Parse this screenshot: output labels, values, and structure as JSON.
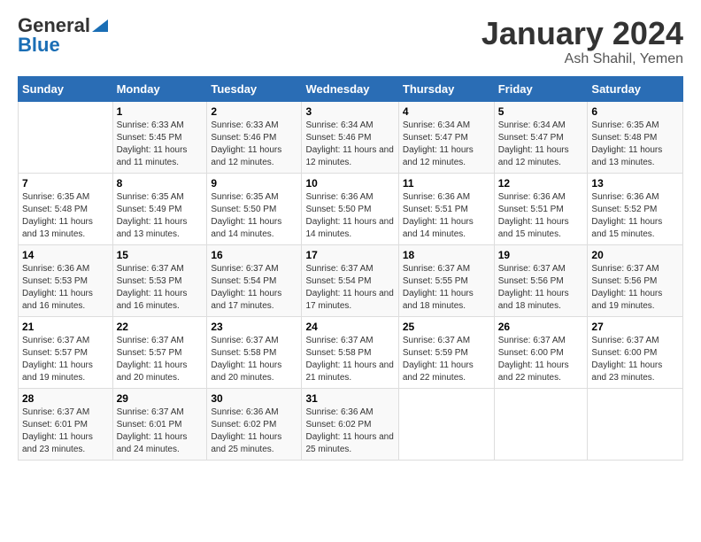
{
  "logo": {
    "general": "General",
    "blue": "Blue"
  },
  "title": {
    "month_year": "January 2024",
    "location": "Ash Shahil, Yemen"
  },
  "weekdays": [
    "Sunday",
    "Monday",
    "Tuesday",
    "Wednesday",
    "Thursday",
    "Friday",
    "Saturday"
  ],
  "weeks": [
    [
      {
        "day": "",
        "sunrise": "",
        "sunset": "",
        "daylight": ""
      },
      {
        "day": "1",
        "sunrise": "Sunrise: 6:33 AM",
        "sunset": "Sunset: 5:45 PM",
        "daylight": "Daylight: 11 hours and 11 minutes."
      },
      {
        "day": "2",
        "sunrise": "Sunrise: 6:33 AM",
        "sunset": "Sunset: 5:46 PM",
        "daylight": "Daylight: 11 hours and 12 minutes."
      },
      {
        "day": "3",
        "sunrise": "Sunrise: 6:34 AM",
        "sunset": "Sunset: 5:46 PM",
        "daylight": "Daylight: 11 hours and 12 minutes."
      },
      {
        "day": "4",
        "sunrise": "Sunrise: 6:34 AM",
        "sunset": "Sunset: 5:47 PM",
        "daylight": "Daylight: 11 hours and 12 minutes."
      },
      {
        "day": "5",
        "sunrise": "Sunrise: 6:34 AM",
        "sunset": "Sunset: 5:47 PM",
        "daylight": "Daylight: 11 hours and 12 minutes."
      },
      {
        "day": "6",
        "sunrise": "Sunrise: 6:35 AM",
        "sunset": "Sunset: 5:48 PM",
        "daylight": "Daylight: 11 hours and 13 minutes."
      }
    ],
    [
      {
        "day": "7",
        "sunrise": "Sunrise: 6:35 AM",
        "sunset": "Sunset: 5:48 PM",
        "daylight": "Daylight: 11 hours and 13 minutes."
      },
      {
        "day": "8",
        "sunrise": "Sunrise: 6:35 AM",
        "sunset": "Sunset: 5:49 PM",
        "daylight": "Daylight: 11 hours and 13 minutes."
      },
      {
        "day": "9",
        "sunrise": "Sunrise: 6:35 AM",
        "sunset": "Sunset: 5:50 PM",
        "daylight": "Daylight: 11 hours and 14 minutes."
      },
      {
        "day": "10",
        "sunrise": "Sunrise: 6:36 AM",
        "sunset": "Sunset: 5:50 PM",
        "daylight": "Daylight: 11 hours and 14 minutes."
      },
      {
        "day": "11",
        "sunrise": "Sunrise: 6:36 AM",
        "sunset": "Sunset: 5:51 PM",
        "daylight": "Daylight: 11 hours and 14 minutes."
      },
      {
        "day": "12",
        "sunrise": "Sunrise: 6:36 AM",
        "sunset": "Sunset: 5:51 PM",
        "daylight": "Daylight: 11 hours and 15 minutes."
      },
      {
        "day": "13",
        "sunrise": "Sunrise: 6:36 AM",
        "sunset": "Sunset: 5:52 PM",
        "daylight": "Daylight: 11 hours and 15 minutes."
      }
    ],
    [
      {
        "day": "14",
        "sunrise": "Sunrise: 6:36 AM",
        "sunset": "Sunset: 5:53 PM",
        "daylight": "Daylight: 11 hours and 16 minutes."
      },
      {
        "day": "15",
        "sunrise": "Sunrise: 6:37 AM",
        "sunset": "Sunset: 5:53 PM",
        "daylight": "Daylight: 11 hours and 16 minutes."
      },
      {
        "day": "16",
        "sunrise": "Sunrise: 6:37 AM",
        "sunset": "Sunset: 5:54 PM",
        "daylight": "Daylight: 11 hours and 17 minutes."
      },
      {
        "day": "17",
        "sunrise": "Sunrise: 6:37 AM",
        "sunset": "Sunset: 5:54 PM",
        "daylight": "Daylight: 11 hours and 17 minutes."
      },
      {
        "day": "18",
        "sunrise": "Sunrise: 6:37 AM",
        "sunset": "Sunset: 5:55 PM",
        "daylight": "Daylight: 11 hours and 18 minutes."
      },
      {
        "day": "19",
        "sunrise": "Sunrise: 6:37 AM",
        "sunset": "Sunset: 5:56 PM",
        "daylight": "Daylight: 11 hours and 18 minutes."
      },
      {
        "day": "20",
        "sunrise": "Sunrise: 6:37 AM",
        "sunset": "Sunset: 5:56 PM",
        "daylight": "Daylight: 11 hours and 19 minutes."
      }
    ],
    [
      {
        "day": "21",
        "sunrise": "Sunrise: 6:37 AM",
        "sunset": "Sunset: 5:57 PM",
        "daylight": "Daylight: 11 hours and 19 minutes."
      },
      {
        "day": "22",
        "sunrise": "Sunrise: 6:37 AM",
        "sunset": "Sunset: 5:57 PM",
        "daylight": "Daylight: 11 hours and 20 minutes."
      },
      {
        "day": "23",
        "sunrise": "Sunrise: 6:37 AM",
        "sunset": "Sunset: 5:58 PM",
        "daylight": "Daylight: 11 hours and 20 minutes."
      },
      {
        "day": "24",
        "sunrise": "Sunrise: 6:37 AM",
        "sunset": "Sunset: 5:58 PM",
        "daylight": "Daylight: 11 hours and 21 minutes."
      },
      {
        "day": "25",
        "sunrise": "Sunrise: 6:37 AM",
        "sunset": "Sunset: 5:59 PM",
        "daylight": "Daylight: 11 hours and 22 minutes."
      },
      {
        "day": "26",
        "sunrise": "Sunrise: 6:37 AM",
        "sunset": "Sunset: 6:00 PM",
        "daylight": "Daylight: 11 hours and 22 minutes."
      },
      {
        "day": "27",
        "sunrise": "Sunrise: 6:37 AM",
        "sunset": "Sunset: 6:00 PM",
        "daylight": "Daylight: 11 hours and 23 minutes."
      }
    ],
    [
      {
        "day": "28",
        "sunrise": "Sunrise: 6:37 AM",
        "sunset": "Sunset: 6:01 PM",
        "daylight": "Daylight: 11 hours and 23 minutes."
      },
      {
        "day": "29",
        "sunrise": "Sunrise: 6:37 AM",
        "sunset": "Sunset: 6:01 PM",
        "daylight": "Daylight: 11 hours and 24 minutes."
      },
      {
        "day": "30",
        "sunrise": "Sunrise: 6:36 AM",
        "sunset": "Sunset: 6:02 PM",
        "daylight": "Daylight: 11 hours and 25 minutes."
      },
      {
        "day": "31",
        "sunrise": "Sunrise: 6:36 AM",
        "sunset": "Sunset: 6:02 PM",
        "daylight": "Daylight: 11 hours and 25 minutes."
      },
      {
        "day": "",
        "sunrise": "",
        "sunset": "",
        "daylight": ""
      },
      {
        "day": "",
        "sunrise": "",
        "sunset": "",
        "daylight": ""
      },
      {
        "day": "",
        "sunrise": "",
        "sunset": "",
        "daylight": ""
      }
    ]
  ]
}
